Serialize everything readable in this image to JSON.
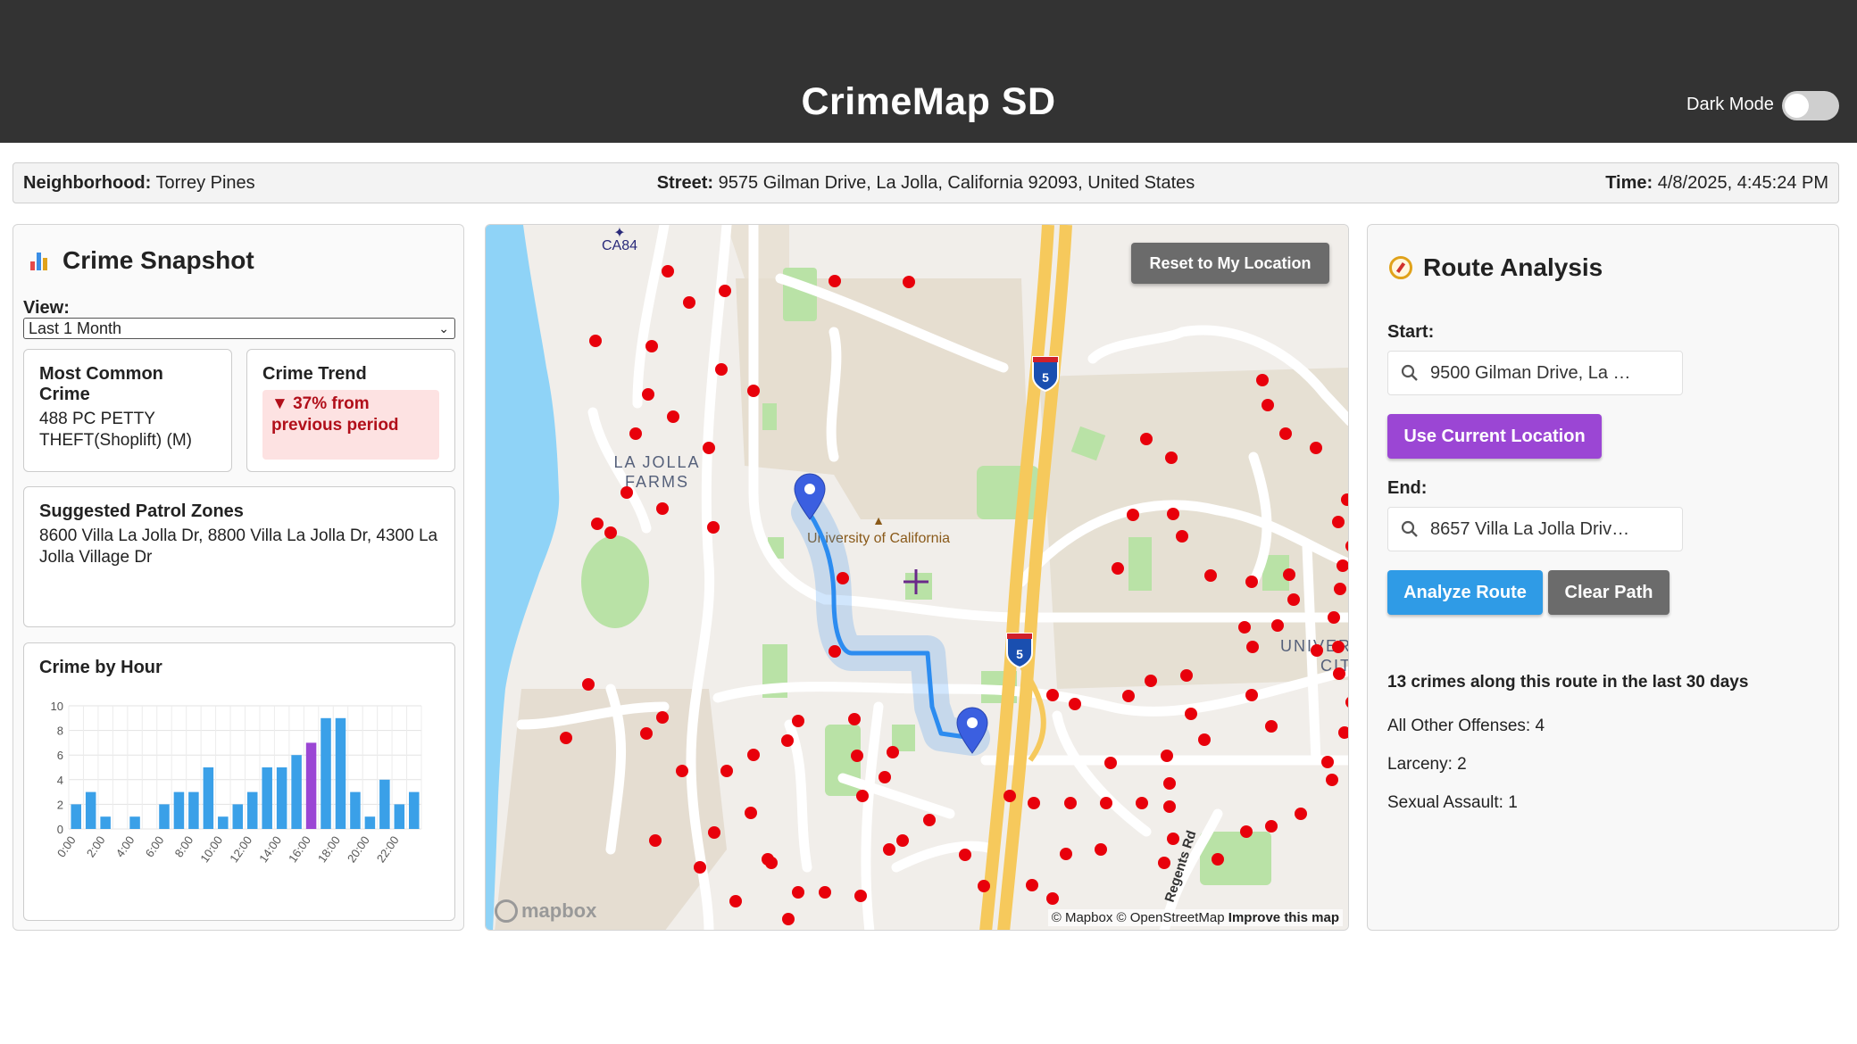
{
  "header": {
    "title": "CrimeMap SD",
    "dark_mode_label": "Dark Mode",
    "dark_mode_on": false
  },
  "infobar": {
    "neighborhood_label": "Neighborhood:",
    "neighborhood_value": "Torrey Pines",
    "street_label": "Street:",
    "street_value": "9575 Gilman Drive, La Jolla, California 92093, United States",
    "time_label": "Time:",
    "time_value": "4/8/2025, 4:45:24 PM"
  },
  "snapshot": {
    "title": "Crime Snapshot",
    "view_label": "View:",
    "view_selected": "Last 1 Month",
    "most_common": {
      "title": "Most Common Crime",
      "value": "488 PC PETTY THEFT(Shoplift) (M)"
    },
    "trend": {
      "title": "Crime Trend",
      "value": "▼ 37% from previous period"
    },
    "patrol": {
      "title": "Suggested Patrol Zones",
      "value": "8600 Villa La Jolla Dr, 8800 Villa La Jolla Dr, 4300 La Jolla Village Dr"
    },
    "hour_chart_title": "Crime by Hour"
  },
  "chart_data": {
    "type": "bar",
    "title": "Crime by Hour",
    "categories": [
      "0:00",
      "1:00",
      "2:00",
      "3:00",
      "4:00",
      "5:00",
      "6:00",
      "7:00",
      "8:00",
      "9:00",
      "10:00",
      "11:00",
      "12:00",
      "13:00",
      "14:00",
      "15:00",
      "16:00",
      "17:00",
      "18:00",
      "19:00",
      "20:00",
      "21:00",
      "22:00",
      "23:00"
    ],
    "tick_labels_shown": [
      "0:00",
      "2:00",
      "4:00",
      "6:00",
      "8:00",
      "10:00",
      "12:00",
      "14:00",
      "16:00",
      "18:00",
      "20:00",
      "22:00"
    ],
    "values": [
      2,
      3,
      1,
      0,
      1,
      0,
      2,
      3,
      3,
      5,
      1,
      2,
      3,
      5,
      5,
      6,
      7,
      9,
      9,
      3,
      1,
      4,
      2,
      3
    ],
    "highlight_index": 16,
    "ylim": [
      0,
      10
    ],
    "yticks": [
      0,
      2,
      4,
      6,
      8,
      10
    ],
    "grid": true,
    "colors": {
      "bar": "#3aa0e8",
      "highlight": "#9b46d4"
    }
  },
  "map": {
    "reset_button": "Reset to My Location",
    "attribution": "© Mapbox © OpenStreetMap",
    "improve_link": "Improve this map",
    "logo_text": "mapbox",
    "labels": {
      "university": "University of California",
      "la_jolla": "LA JOLLA",
      "farms": "FARMS",
      "airport": "CA84",
      "interstate": "5",
      "univer": "UNIVER",
      "cit": "CIT",
      "regents": "Regents Rd"
    },
    "colors": {
      "crime_dot": "#e8000b",
      "route": "#2c8cf0",
      "pin": "#3b5fe0",
      "water": "#8fd3f7",
      "park": "#b9e2a6",
      "highway": "#f6c95c"
    }
  },
  "route": {
    "title": "Route Analysis",
    "start_label": "Start:",
    "start_value": "9500 Gilman Drive, La …",
    "use_current": "Use Current Location",
    "end_label": "End:",
    "end_value": "8657 Villa La Jolla Driv…",
    "analyze": "Analyze Route",
    "clear": "Clear Path",
    "summary": "13 crimes along this route in the last 30 days",
    "breakdown": [
      "All Other Offenses: 4",
      "Larceny: 2",
      "Sexual Assault: 1"
    ]
  }
}
